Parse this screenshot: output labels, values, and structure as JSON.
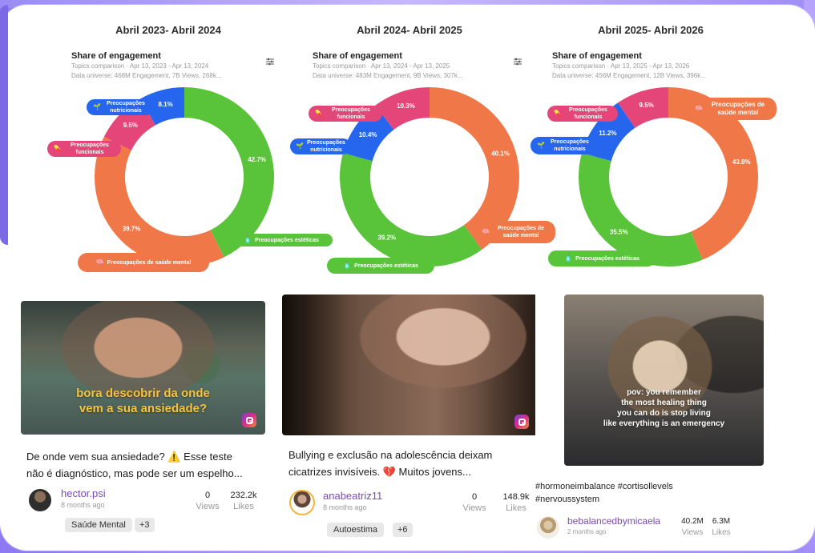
{
  "panels": [
    {
      "title": "Abril 2023- Abril 2024",
      "share_title": "Share of engagement",
      "range_text": "Topics comparison · Apr 13, 2023 - Apr 13, 2024",
      "universe_text": "Data universe: 468M Engagement, 7B Views, 268k...",
      "filter_icon": "sliders-icon",
      "segments": [
        {
          "label": "Preocupações estéticas",
          "value": 42.7,
          "color": "#59c33a"
        },
        {
          "label": "Preocupações de saúde mental",
          "value": 39.7,
          "color": "#f07747"
        },
        {
          "label": "Preocupações funcionais",
          "value": 9.5,
          "color": "#e54679"
        },
        {
          "label": "Preocupações nutricionais",
          "value": 8.1,
          "color": "#2666ee"
        }
      ],
      "value_labels": [
        "42.7%",
        "39.7%",
        "9.5%",
        "8.1%"
      ],
      "pills": [
        "Preocupações estéticas",
        "Preocupações de saúde mental",
        "Preocupações funcionais",
        "Preocupações nutricionais"
      ]
    },
    {
      "title": "Abril 2024- Abril 2025",
      "share_title": "Share of engagement",
      "range_text": "Topics comparison · Apr 13, 2024 - Apr 13, 2025",
      "universe_text": "Data universe: 483M Engagement, 9B Views, 307k...",
      "filter_icon": "sliders-icon",
      "segments": [
        {
          "label": "Preocupações de saúde mental",
          "value": 40.1,
          "color": "#f07747"
        },
        {
          "label": "Preocupações estéticas",
          "value": 39.2,
          "color": "#59c33a"
        },
        {
          "label": "Preocupações nutricionais",
          "value": 10.4,
          "color": "#2666ee"
        },
        {
          "label": "Preocupações funcionais",
          "value": 10.3,
          "color": "#e54679"
        }
      ],
      "value_labels": [
        "40.1%",
        "39.2%",
        "10.4%",
        "10.3%"
      ],
      "pills": [
        "Preocupações de saúde mental",
        "Preocupações estéticas",
        "Preocupações nutricionais",
        "Preocupações funcionais"
      ]
    },
    {
      "title": "Abril 2025- Abril 2026",
      "share_title": "Share of engagement",
      "range_text": "Topics comparison · Apr 13, 2025 - Apr 13, 2026",
      "universe_text": "Data universe: 456M Engagement, 12B Views, 396k...",
      "filter_icon": "sliders-icon",
      "segments": [
        {
          "label": "Preocupações de saúde mental",
          "value": 43.8,
          "color": "#f07747"
        },
        {
          "label": "Preocupações estéticas",
          "value": 35.5,
          "color": "#59c33a"
        },
        {
          "label": "Preocupações nutricionais",
          "value": 11.2,
          "color": "#2666ee"
        },
        {
          "label": "Preocupações funcionais",
          "value": 9.5,
          "color": "#e54679"
        }
      ],
      "value_labels": [
        "43.8%",
        "35.5%",
        "11.2%",
        "9.5%"
      ],
      "pills": [
        "Preocupações de saúde mental",
        "Preocupações estéticas",
        "Preocupações nutricionais",
        "Preocupações funcionais"
      ]
    }
  ],
  "cards": [
    {
      "overlay_text_1": "bora descobrir da onde",
      "overlay_text_2": "vem a sua ansiedade?",
      "caption_1": "De onde vem sua ansiedade? ⚠️ Esse teste",
      "caption_2": "não é diagnóstico, mas pode ser um espelho...",
      "author": "hector.psi",
      "time": "8 months ago",
      "views": "0",
      "views_label": "Views",
      "likes": "232.2k",
      "likes_label": "Likes",
      "tag": "Saúde Mental",
      "extra": "+3",
      "platform_icon": "instagram-icon"
    },
    {
      "caption_1": "Bullying e exclusão na adolescência deixam",
      "caption_2": "cicatrizes invisíveis. 💔 Muitos jovens...",
      "author": "anabeatriz11",
      "time": "8 months ago",
      "views": "0",
      "views_label": "Views",
      "likes": "148.9k",
      "likes_label": "Likes",
      "tag": "Autoestima",
      "extra": "+6",
      "platform_icon": "instagram-icon"
    },
    {
      "overlay_1": "pov: you remember",
      "overlay_2": "the most healing thing",
      "overlay_3": "you can do is stop living",
      "overlay_4": "like everything is an emergency",
      "hashtags_1": "#hormoneimbalance #cortisollevels",
      "hashtags_2": "#nervoussystem",
      "author": "bebalancedbymicaela",
      "time": "2 months ago",
      "views": "40.2M",
      "views_label": "Views",
      "likes": "6.3M",
      "likes_label": "Likes"
    }
  ],
  "colors": {
    "green": "#59c33a",
    "orange": "#f07747",
    "blue": "#2666ee",
    "pink": "#e54679",
    "purple_bg": "#9d8cf7"
  }
}
